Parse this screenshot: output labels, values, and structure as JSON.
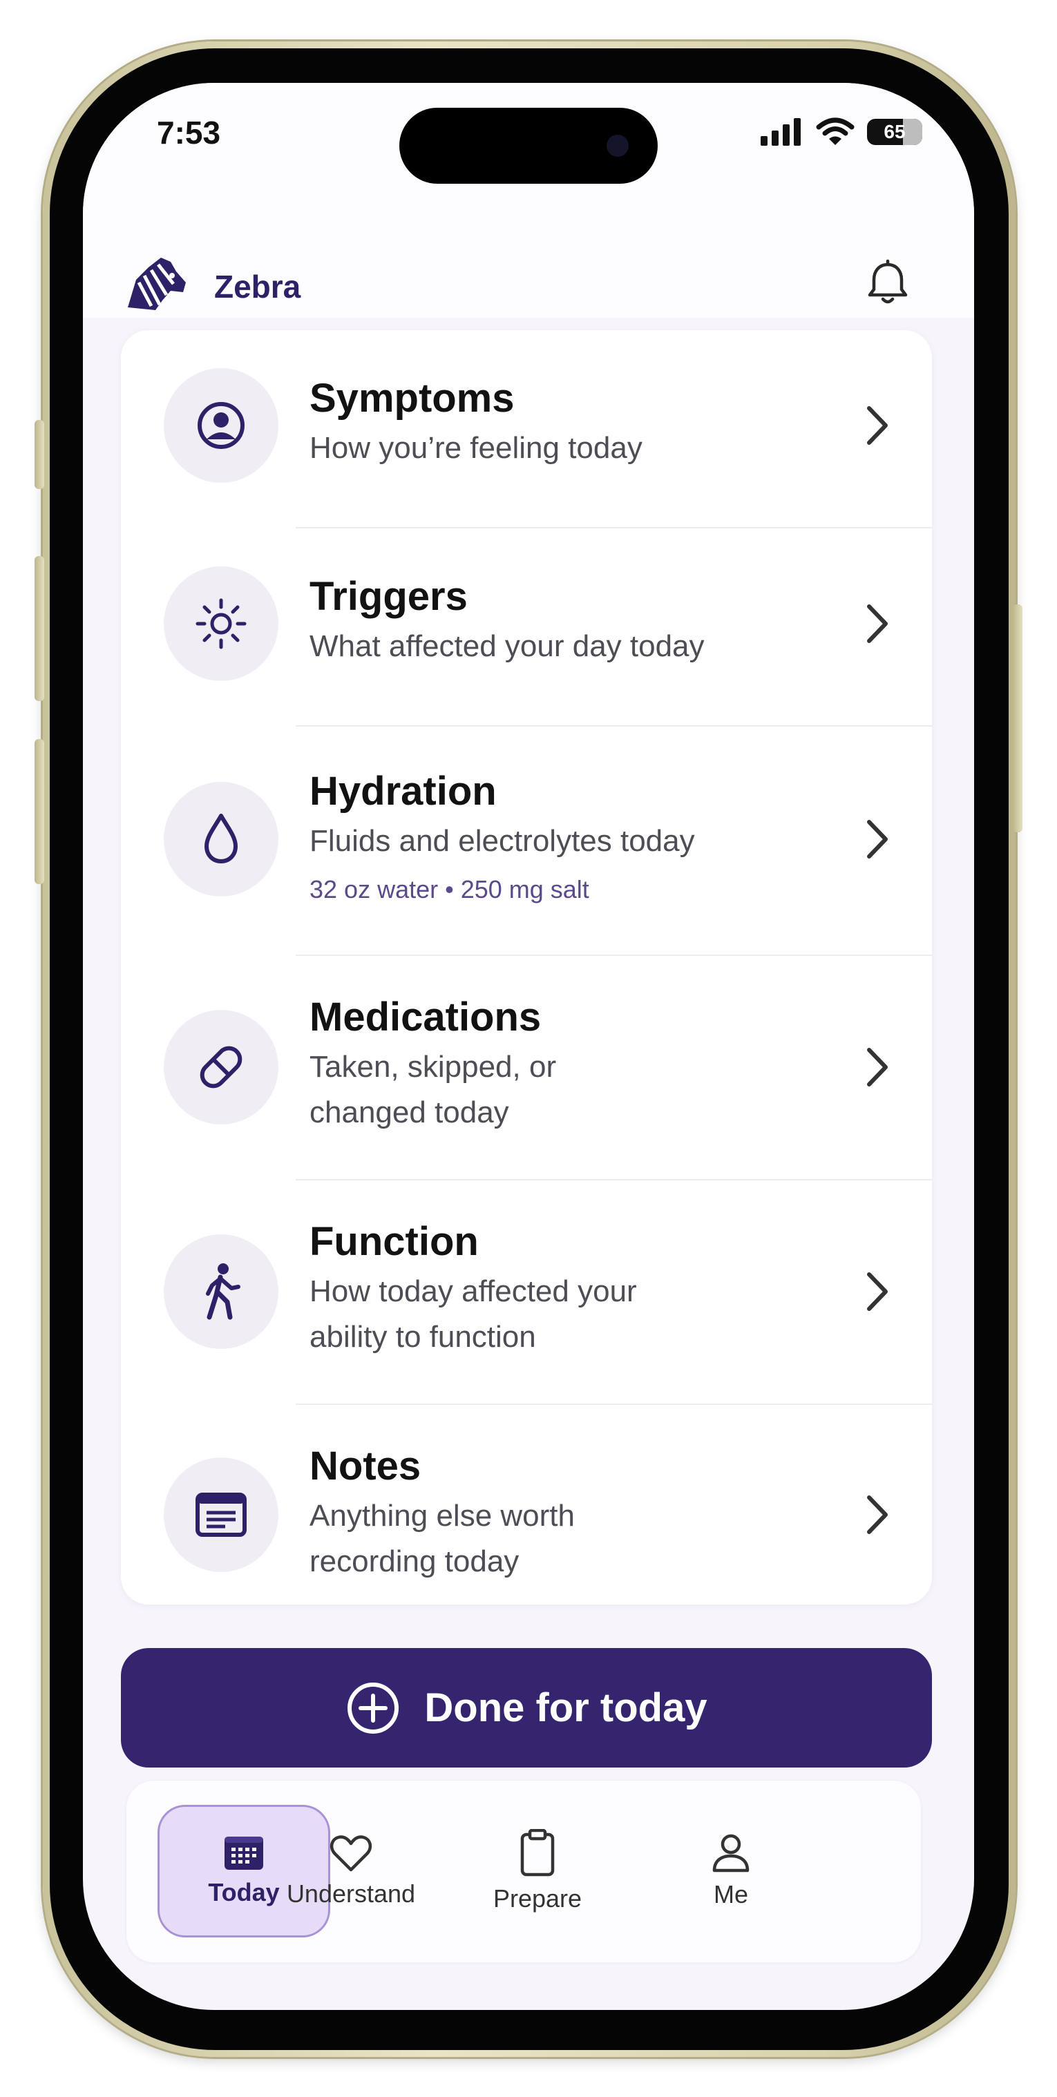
{
  "status_bar": {
    "time": "7:53",
    "battery": "65"
  },
  "header": {
    "brand": "Zebra"
  },
  "checklist": [
    {
      "title": "Symptoms",
      "subtitle": "How you’re feeling today",
      "icon": "person-circle-icon"
    },
    {
      "title": "Triggers",
      "subtitle": "What affected your day today",
      "icon": "sun-icon"
    },
    {
      "title": "Hydration",
      "subtitle": "Fluids and electrolytes today",
      "detail": "32 oz water • 250 mg salt",
      "icon": "droplet-icon"
    },
    {
      "title": "Medications",
      "subtitle": "Taken, skipped, or changed today",
      "icon": "pill-icon"
    },
    {
      "title": "Function",
      "subtitle": "How today affected your ability to function",
      "icon": "walking-person-icon"
    },
    {
      "title": "Notes",
      "subtitle": "Anything else worth recording today",
      "icon": "note-icon"
    }
  ],
  "done_button": {
    "label": "Done for today"
  },
  "tabs": [
    {
      "label": "Today",
      "icon": "calendar-icon",
      "active": true
    },
    {
      "label": "Understand",
      "icon": "heart-icon",
      "active": false
    },
    {
      "label": "Prepare",
      "icon": "clipboard-icon",
      "active": false
    },
    {
      "label": "Me",
      "icon": "person-icon",
      "active": false
    }
  ],
  "colors": {
    "brand": "#2e2168",
    "primary_button": "#35256f",
    "active_tab_bg": "#e6dcf7",
    "icon_circle": "#f1edf4"
  }
}
